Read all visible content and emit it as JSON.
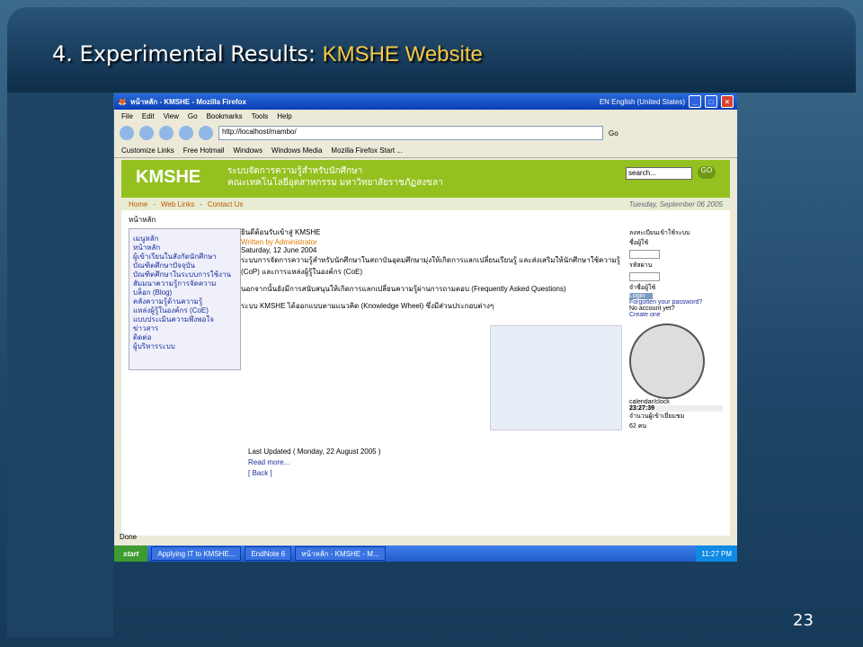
{
  "slide": {
    "title_main": "4. Experimental Results:",
    "title_accent": "KMSHE Website",
    "page_number": "23"
  },
  "browser": {
    "window_title": "หน้าหลัก - KMSHE - Mozilla Firefox",
    "language": "EN English (United States)",
    "menu": [
      "File",
      "Edit",
      "View",
      "Go",
      "Bookmarks",
      "Tools",
      "Help"
    ],
    "url": "http://localhost/mambo/",
    "go_label": "Go",
    "links": [
      "Customize Links",
      "Free Hotmail",
      "Windows",
      "Windows Media",
      "Mozilla Firefox Start ..."
    ],
    "status": "Done"
  },
  "site": {
    "logo": "KMSHE",
    "th_line1": "ระบบจัดการความรู้สำหรับนักศึกษา",
    "th_line2": "คณะเทคโนโลยีอุตสาหกรรม มหาวิทยาลัยราชภัฏสงขลา",
    "search_placeholder": "search...",
    "go": "GO",
    "nav": [
      "Home",
      "Web Links",
      "Contact Us"
    ],
    "date": "Tuesday, September 06 2005",
    "breadcrumb": "หน้าหลัก",
    "main_menu": [
      "เมนูหลัก",
      "หน้าหลัก",
      "ผู้เข้าเรียนในสังกัดนักศึกษา",
      "บัณฑิตศึกษาปัจจุบัน",
      "บัณฑิตศึกษาในระบบการใช้งาน",
      "สัมมนาความรู้การจัดความ",
      "บล็อก (Blog)",
      "คลังความรู้ด้านความรู้",
      "แหล่งผู้รู้ในองค์กร (CoE)",
      "แบบประเมินความพึงพอใจ",
      "ข่าวสาร",
      "ติดต่อ",
      "ผู้บริหารระบบ"
    ],
    "welcome": "ยินดีต้อนรับเข้าสู่ KMSHE",
    "written_by": "Written by Administrator",
    "date_posted": "Saturday, 12 June 2004",
    "para1": "ระบบการจัดการความรู้สำหรับนักศึกษาในสถาบันอุดมศึกษามุ่งให้เกิดการแลกเปลี่ยนเรียนรู้ และส่งเสริมให้นักศึกษาใช้ความรู้ (CoP) และการแหล่งผู้รู้ในองค์กร (CoE)",
    "para2": "นอกจากนั้นยังมีการสนับสนุนให้เกิดการแลกเปลี่ยนความรู้ผ่านการถามตอบ (Frequently Asked Questions)",
    "para3": "ระบบ KMSHE ได้ออกแบบตามแนวคิด (Knowledge Wheel) ซึ่งมีส่วนประกอบต่างๆ",
    "last_updated": "Last Updated ( Monday, 22 August 2005 )",
    "read_more": "Read more...",
    "back": "[ Back ]",
    "login_title": "ลงทะเบียนเข้าใช้ระบบ",
    "username_label": "ชื่อผู้ใช้",
    "password_label": "รหัสผ่าน",
    "remember": "จำชื่อผู้ใช้",
    "login_btn": "Login",
    "forgot": "Forgotten your password?",
    "no_account": "No account yet?",
    "create": "Create one",
    "clock_label": "calendar/clock",
    "clock_time": "23:27:39",
    "visitors_label": "จำนวนผู้เข้าเยี่ยมชม",
    "visitors": "62 คน"
  },
  "taskbar": {
    "start": "start",
    "tasks": [
      "Applying IT to KMSHE...",
      "EndNote 6",
      "หน้าหลัก - KMSHE - M..."
    ],
    "time": "11:27 PM"
  }
}
